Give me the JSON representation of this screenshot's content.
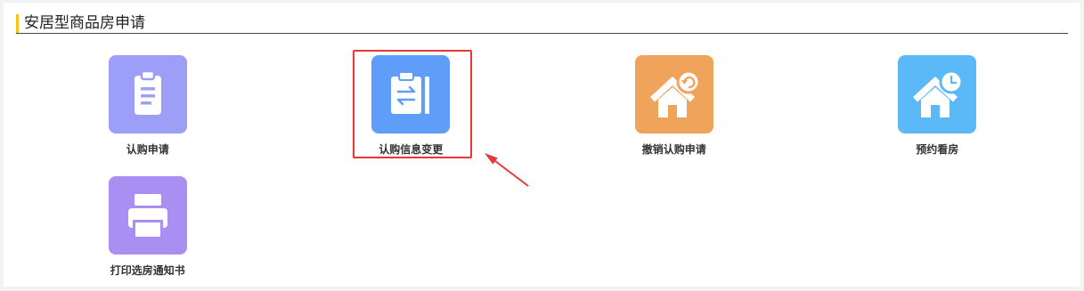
{
  "section": {
    "title": "安居型商品房申请",
    "accent_color": "#f6c21c"
  },
  "tiles": [
    {
      "label": "认购申请",
      "icon": "clipboard-icon",
      "color": "#9c9ef8"
    },
    {
      "label": "认购信息变更",
      "icon": "clipboard-swap-icon",
      "color": "#5e9ef8"
    },
    {
      "label": "撤销认购申请",
      "icon": "house-undo-icon",
      "color": "#f0a35b"
    },
    {
      "label": "预约看房",
      "icon": "house-clock-icon",
      "color": "#5bb9f7"
    },
    {
      "label": "打印选房通知书",
      "icon": "printer-icon",
      "color": "#a88ff1"
    }
  ],
  "annotation": {
    "color": "#e53935"
  }
}
